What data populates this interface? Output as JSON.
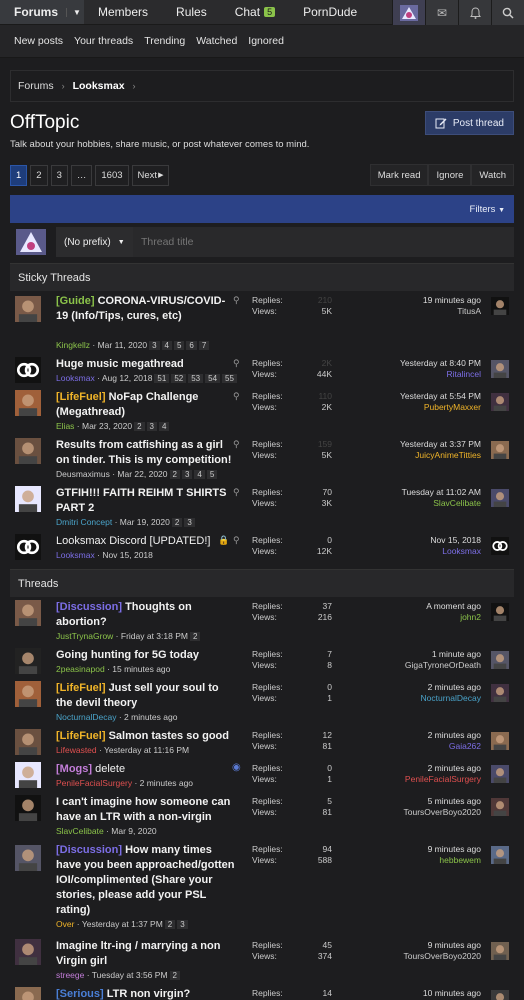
{
  "nav": {
    "tabs": [
      "Forums",
      "Members",
      "Rules",
      "Chat",
      "PornDude"
    ],
    "chat_badge": "5",
    "sub": [
      "New posts",
      "Your threads",
      "Trending",
      "Watched",
      "Ignored"
    ]
  },
  "breadcrumb": {
    "root": "Forums",
    "current": "Looksmax"
  },
  "page": {
    "title": "OffTopic",
    "description": "Talk about your hobbies, share music, or post whatever comes to mind.",
    "post_button": "Post thread"
  },
  "pager": {
    "pages": [
      "1",
      "2",
      "3",
      "…",
      "1603"
    ],
    "next": "Next"
  },
  "actions": [
    "Mark read",
    "Ignore",
    "Watch"
  ],
  "filters_label": "Filters",
  "quick_thread": {
    "prefix": "(No prefix)",
    "placeholder": "Thread title"
  },
  "sections": {
    "sticky": "Sticky Threads",
    "threads": "Threads"
  },
  "labels": {
    "replies": "Replies:",
    "views": "Views:"
  },
  "colors": {
    "lifefuel": "#f0b429",
    "discussion": "#7c6ee6",
    "mogs": "#c27dd8",
    "guide": "#8bc34a",
    "serious": "#4a7fd6"
  },
  "sticky_threads": [
    {
      "prefix": "[Guide]",
      "prefix_color": "#8bc34a",
      "title": "CORONA-VIRUS/COVID-19 (Info/Tips, cures, etc)",
      "author": "Kingkellz",
      "author_color": "#8bc34a",
      "date": "Mar 11, 2020",
      "pages": [
        "3",
        "4",
        "5",
        "6",
        "7"
      ],
      "replies": "210",
      "views": "5K",
      "last_time": "19 minutes ago",
      "last_user": "TitusA",
      "last_color": "#cccccc"
    },
    {
      "prefix": "",
      "prefix_color": "",
      "title": "Huge music megathread",
      "author": "Looksmax",
      "author_color": "#7c6ee6",
      "date": "Aug 12, 2018",
      "pages": [
        "51",
        "52",
        "53",
        "54",
        "55"
      ],
      "replies": "2K",
      "views": "44K",
      "last_time": "Yesterday at 8:40 PM",
      "last_user": "Ritalincel",
      "last_color": "#7c6ee6"
    },
    {
      "prefix": "[LifeFuel]",
      "prefix_color": "#f0b429",
      "title": "NoFap Challenge (Megathread)",
      "author": "Elias",
      "author_color": "#8bc34a",
      "date": "Mar 23, 2020",
      "pages": [
        "2",
        "3",
        "4"
      ],
      "replies": "110",
      "views": "2K",
      "last_time": "Yesterday at 5:54 PM",
      "last_user": "PubertyMaxxer",
      "last_color": "#f0b429"
    },
    {
      "prefix": "",
      "prefix_color": "",
      "title": "Results from catfishing as a girl on tinder. This is my competition!",
      "author": "Deusmaximus",
      "author_color": "#cccccc",
      "date": "Mar 22, 2020",
      "pages": [
        "2",
        "3",
        "4",
        "5"
      ],
      "replies": "159",
      "views": "5K",
      "last_time": "Yesterday at 3:37 PM",
      "last_user": "JuicyAnimeTitties",
      "last_color": "#f0b429"
    },
    {
      "prefix": "",
      "prefix_color": "",
      "title": "GTFIH!!! FAITH REIHM T SHIRTS PART 2",
      "author": "Dmitri Concept",
      "author_color": "#4aa3c9",
      "date": "Mar 19, 2020",
      "pages": [
        "2",
        "3"
      ],
      "replies": "70",
      "views": "3K",
      "last_time": "Tuesday at 11:02 AM",
      "last_user": "SlavCelibate",
      "last_color": "#8bc34a"
    },
    {
      "prefix": "",
      "prefix_color": "",
      "title": "Looksmax Discord [UPDATED!]",
      "author": "Looksmax",
      "author_color": "#7c6ee6",
      "date": "Nov 15, 2018",
      "pages": [],
      "replies": "0",
      "views": "12K",
      "last_time": "Nov 15, 2018",
      "last_user": "Looksmax",
      "last_color": "#7c6ee6",
      "locked": true
    }
  ],
  "threads": [
    {
      "prefix": "[Discussion]",
      "prefix_color": "#7c6ee6",
      "title": "Thoughts on abortion?",
      "author": "JustTrynaGrow",
      "author_color": "#8bc34a",
      "date": "Friday at 3:18 PM",
      "pages": [
        "2"
      ],
      "replies": "37",
      "views": "216",
      "last_time": "A moment ago",
      "last_user": "john2",
      "last_color": "#8bc34a"
    },
    {
      "prefix": "",
      "prefix_color": "",
      "title": "Going hunting for 5G today",
      "author": "2peasinapod",
      "author_color": "#8bc34a",
      "date": "15 minutes ago",
      "pages": [],
      "replies": "7",
      "views": "8",
      "last_time": "1 minute ago",
      "last_user": "GigaTyroneOrDeath",
      "last_color": "#cccccc"
    },
    {
      "prefix": "[LifeFuel]",
      "prefix_color": "#f0b429",
      "title": "Just sell your soul to the devil theory",
      "author": "NocturnalDecay",
      "author_color": "#4aa3c9",
      "date": "2 minutes ago",
      "pages": [],
      "replies": "0",
      "views": "1",
      "last_time": "2 minutes ago",
      "last_user": "NocturnalDecay",
      "last_color": "#4aa3c9"
    },
    {
      "prefix": "[LifeFuel]",
      "prefix_color": "#f0b429",
      "title": "Salmon tastes so good",
      "author": "Lifewasted",
      "author_color": "#e05050",
      "date": "Yesterday at 11:16 PM",
      "pages": [],
      "replies": "12",
      "views": "81",
      "last_time": "2 minutes ago",
      "last_user": "Gaia262",
      "last_color": "#7c6ee6"
    },
    {
      "prefix": "[Mogs]",
      "prefix_color": "#c27dd8",
      "title": "delete",
      "author": "PenileFacialSurgery",
      "author_color": "#e05050",
      "date": "2 minutes ago",
      "pages": [],
      "replies": "0",
      "views": "1",
      "last_time": "2 minutes ago",
      "last_user": "PenileFacialSurgery",
      "last_color": "#e05050",
      "watched": true,
      "plain": true
    },
    {
      "prefix": "",
      "prefix_color": "",
      "title": "I can't imagine how someone can have an LTR with a non-virgin",
      "author": "SlavCelibate",
      "author_color": "#8bc34a",
      "date": "Mar 9, 2020",
      "pages": [],
      "replies": "5",
      "views": "81",
      "last_time": "5 minutes ago",
      "last_user": "ToursOverBoyo2020",
      "last_color": "#cccccc"
    },
    {
      "prefix": "[Discussion]",
      "prefix_color": "#7c6ee6",
      "title": "How many times have you been approached/gotten IOI/complimented (Share your stories, please add your PSL rating)",
      "author": "Over",
      "author_color": "#f0b429",
      "date": "Yesterday at 1:37 PM",
      "pages": [
        "2",
        "3"
      ],
      "replies": "94",
      "views": "588",
      "last_time": "9 minutes ago",
      "last_user": "hebbewem",
      "last_color": "#8bc34a"
    },
    {
      "prefix": "",
      "prefix_color": "",
      "title": "Imagine ltr-ing / marrying a non Virgin girl",
      "author": "streege",
      "author_color": "#c27dd8",
      "date": "Tuesday at 3:56 PM",
      "pages": [
        "2"
      ],
      "replies": "45",
      "views": "374",
      "last_time": "9 minutes ago",
      "last_user": "ToursOverBoyo2020",
      "last_color": "#cccccc"
    },
    {
      "prefix": "[Serious]",
      "prefix_color": "#4a7fd6",
      "title": "LTR non virgin?",
      "author": "",
      "author_color": "#cccccc",
      "date": "",
      "pages": [],
      "replies": "14",
      "views": "",
      "last_time": "10 minutes ago",
      "last_user": "",
      "last_color": "#cccccc"
    }
  ]
}
